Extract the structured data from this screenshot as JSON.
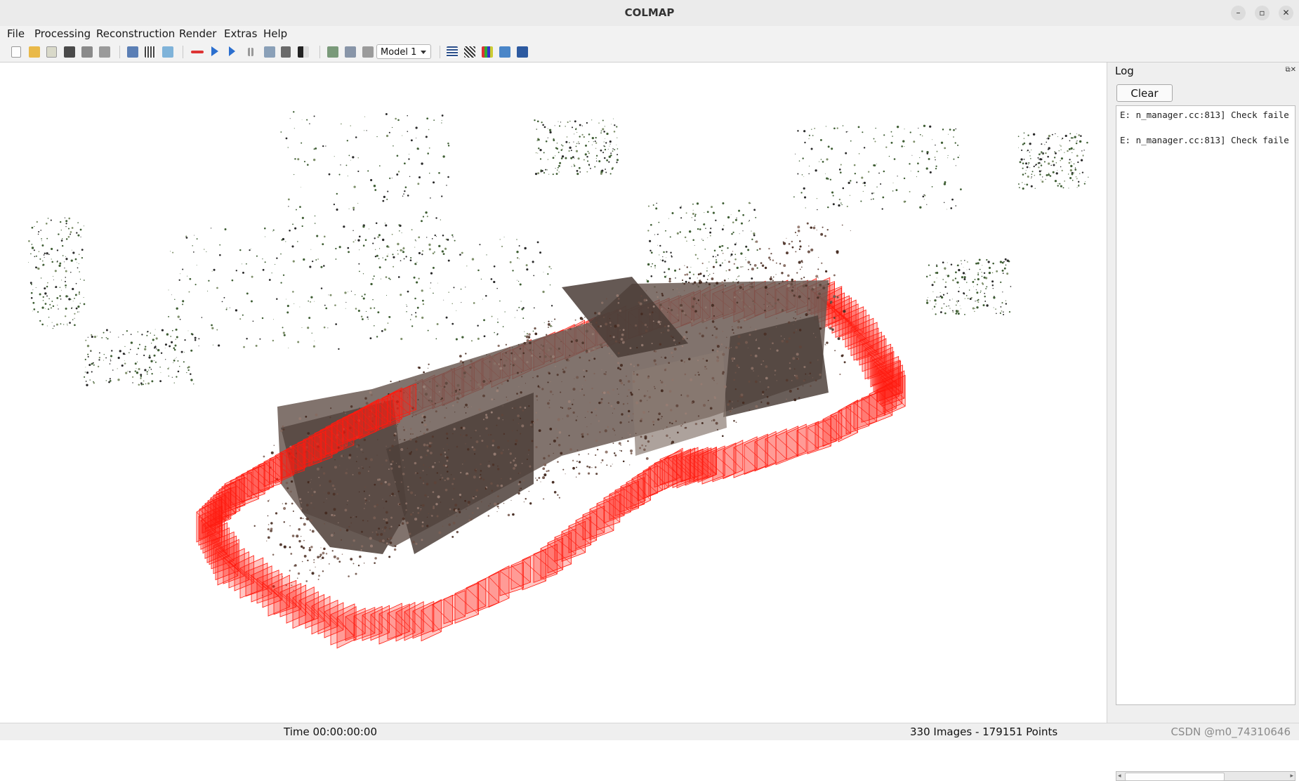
{
  "window": {
    "title": "COLMAP"
  },
  "menu": [
    "File",
    "Processing",
    "Reconstruction",
    "Render",
    "Extras",
    "Help"
  ],
  "toolbar": {
    "model_select": "Model 1",
    "icons": [
      "new-project-icon",
      "open-project-icon",
      "edit-project-icon",
      "save-project-icon",
      "import-model-icon",
      "export-model-icon",
      "feature-extraction-icon",
      "feature-matching-icon",
      "database-management-icon",
      "reconstruction-options-icon",
      "start-reconstruction-icon",
      "step-reconstruction-icon",
      "pause-reconstruction-icon",
      "bundle-adjustment-icon",
      "dense-reconstruction-icon",
      "render-options-icon",
      "grab-image-icon",
      "grab-movie-icon",
      "undistort-icon",
      "reconstruction-stats-icon",
      "match-matrix-icon",
      "show-log-icon",
      "render-toggle-icon",
      "screenshot-icon"
    ]
  },
  "log": {
    "title": "Log",
    "clear_label": "Clear",
    "lines": [
      "E: n_manager.cc:813] Check faile",
      "E: n_manager.cc:813] Check faile"
    ]
  },
  "status": {
    "time": "Time 00:00:00:00",
    "stats": "330 Images - 179151 Points",
    "watermark": "CSDN @m0_74310646"
  },
  "colors": {
    "camera_frustums": "#ff1a0f",
    "point_cloud_building": "#4a3a34",
    "point_cloud_vegetation": "#3f5e34"
  }
}
